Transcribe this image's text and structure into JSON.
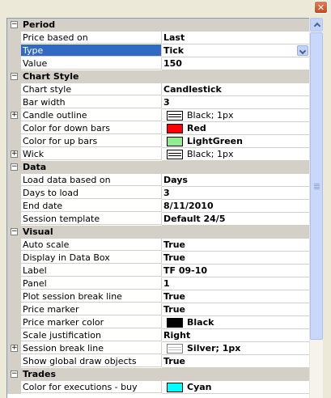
{
  "window": {
    "close_glyph": "✕"
  },
  "grid": {
    "rows": [
      {
        "kind": "category",
        "label": "Period"
      },
      {
        "kind": "prop",
        "name": "Price based on",
        "value": "Last"
      },
      {
        "kind": "prop",
        "name": "Type",
        "value": "Tick",
        "selected": true,
        "dropdown": true
      },
      {
        "kind": "prop",
        "name": "Value",
        "value": "150"
      },
      {
        "kind": "category",
        "label": "Chart Style"
      },
      {
        "kind": "prop",
        "name": "Chart style",
        "value": "Candlestick"
      },
      {
        "kind": "prop",
        "name": "Bar width",
        "value": "3"
      },
      {
        "kind": "prop",
        "name": "Candle outline",
        "value": "Black; 1px",
        "expandable": true,
        "swatch": "lines",
        "normal": true
      },
      {
        "kind": "prop",
        "name": "Color for down bars",
        "value": "Red",
        "swatch_color": "#ff0000"
      },
      {
        "kind": "prop",
        "name": "Color for up bars",
        "value": "LightGreen",
        "swatch_color": "#90ee90"
      },
      {
        "kind": "prop",
        "name": "Wick",
        "value": "Black; 1px",
        "expandable": true,
        "swatch": "lines",
        "normal": true
      },
      {
        "kind": "category",
        "label": "Data"
      },
      {
        "kind": "prop",
        "name": "Load data based on",
        "value": "Days"
      },
      {
        "kind": "prop",
        "name": "Days to load",
        "value": "3"
      },
      {
        "kind": "prop",
        "name": "End date",
        "value": "8/11/2010"
      },
      {
        "kind": "prop",
        "name": "Session template",
        "value": "Default 24/5"
      },
      {
        "kind": "category",
        "label": "Visual"
      },
      {
        "kind": "prop",
        "name": "Auto scale",
        "value": "True"
      },
      {
        "kind": "prop",
        "name": "Display in Data Box",
        "value": "True"
      },
      {
        "kind": "prop",
        "name": "Label",
        "value": "TF 09-10"
      },
      {
        "kind": "prop",
        "name": "Panel",
        "value": "1"
      },
      {
        "kind": "prop",
        "name": "Plot session break line",
        "value": "True"
      },
      {
        "kind": "prop",
        "name": "Price marker",
        "value": "True"
      },
      {
        "kind": "prop",
        "name": "Price marker color",
        "value": "Black",
        "swatch_color": "#000000"
      },
      {
        "kind": "prop",
        "name": "Scale justification",
        "value": "Right"
      },
      {
        "kind": "prop",
        "name": "Session break line",
        "value": "Silver; 1px",
        "expandable": true,
        "swatch": "silver"
      },
      {
        "kind": "prop",
        "name": "Show global draw objects",
        "value": "True"
      },
      {
        "kind": "category",
        "label": "Trades"
      },
      {
        "kind": "prop",
        "name": "Color for executions - buy",
        "value": "Cyan",
        "swatch_color": "#00ffff"
      }
    ]
  }
}
